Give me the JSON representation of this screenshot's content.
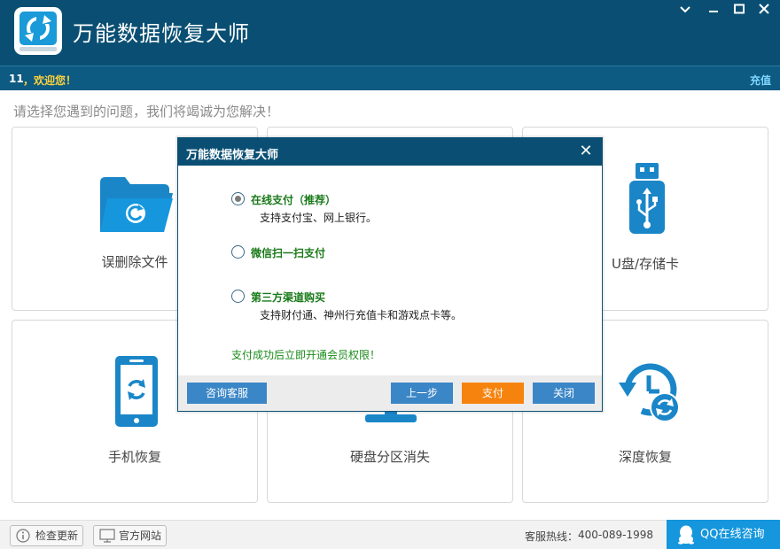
{
  "window": {
    "title": "万能数据恢复大师",
    "controls": [
      "chevron-down-icon",
      "minimize-icon",
      "maximize-icon",
      "close-icon"
    ]
  },
  "user": {
    "id": "11",
    "welcome": "，欢迎您！",
    "recharge": "充值"
  },
  "main": {
    "prompt": "请选择您遇到的问题，我们将竭诚为您解决！",
    "cards": [
      {
        "label": "误删除文件",
        "icon": "folder-restore-icon"
      },
      {
        "label": "",
        "icon": ""
      },
      {
        "label": "U盘/存储卡",
        "icon": "usb-drive-icon"
      },
      {
        "label": "手机恢复",
        "icon": "phone-restore-icon"
      },
      {
        "label": "硬盘分区消失",
        "icon": "disk-partition-icon"
      },
      {
        "label": "深度恢复",
        "icon": "clock-restore-icon"
      }
    ]
  },
  "statusbar": {
    "check_update": "检查更新",
    "official_site": "官方网站",
    "hotline_label": "客服热线：",
    "hotline_number": "400-089-1998",
    "qq_consult": "QQ在线咨询"
  },
  "dialog": {
    "title": "万能数据恢复大师",
    "options": [
      {
        "title": "在线支付（推荐）",
        "desc": "支持支付宝、网上银行。",
        "selected": true
      },
      {
        "title": "微信扫一扫支付",
        "desc": "",
        "selected": false
      },
      {
        "title": "第三方渠道购买",
        "desc": "支持财付通、神州行充值卡和游戏点卡等。",
        "selected": false
      }
    ],
    "note": "支付成功后立即开通会员权限！",
    "buttons": {
      "consult": "咨询客服",
      "prev": "上一步",
      "pay": "支付",
      "close": "关闭"
    }
  },
  "colors": {
    "titlebar": "#0a4f73",
    "accent_blue": "#1596dd",
    "pay_orange": "#f7830f",
    "option_green": "#1a7a1a"
  }
}
